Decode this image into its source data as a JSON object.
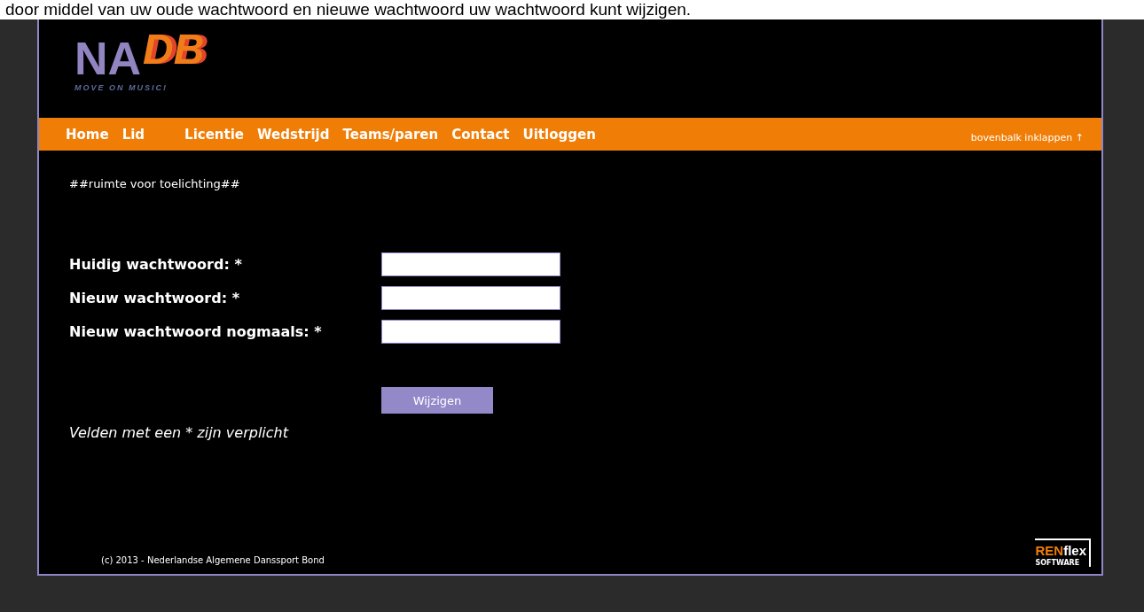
{
  "intro_text": "door middel van uw oude wachtwoord en nieuwe wachtwoord uw wachtwoord kunt wijzigen.",
  "logo": {
    "letters_left": "NA",
    "letters_right": "DB",
    "tagline": "MOVE ON MUSIC!"
  },
  "nav": {
    "items": [
      {
        "label": "Home"
      },
      {
        "label": "Lid"
      },
      {
        "label": "Licentie"
      },
      {
        "label": "Wedstrijd"
      },
      {
        "label": "Teams/paren"
      },
      {
        "label": "Contact"
      },
      {
        "label": "Uitloggen"
      }
    ],
    "collapse_link": "bovenbalk inklappen ↑"
  },
  "explanation": "##ruimte voor toelichting##",
  "form": {
    "fields": [
      {
        "label": "Huidig wachtwoord: *"
      },
      {
        "label": "Nieuw wachtwoord: *"
      },
      {
        "label": "Nieuw wachtwoord nogmaals: *"
      }
    ],
    "submit": "Wijzigen",
    "required_note": "Velden met een * zijn verplicht"
  },
  "footer": {
    "copyright": "(c) 2013 - Nederlandse Algemene Danssport Bond",
    "vendor_logo": {
      "part_1": "REN",
      "part_2": "flex",
      "tagline": "SOFTWARE"
    }
  }
}
